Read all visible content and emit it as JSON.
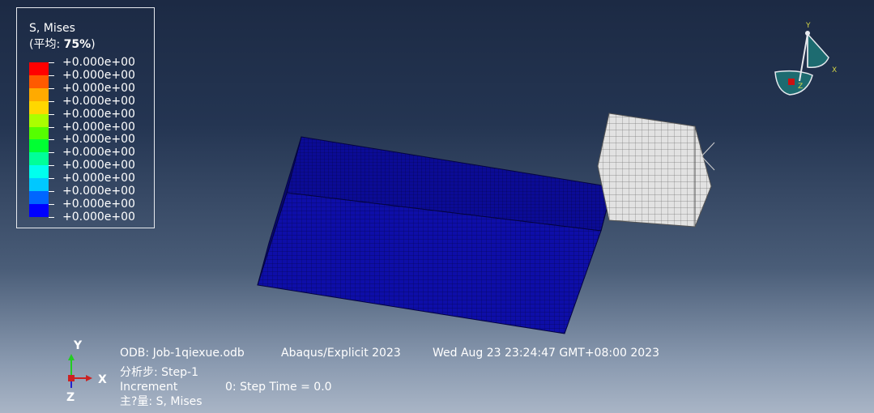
{
  "legend": {
    "title": "S, Mises",
    "subtitle_prefix": "(平均: ",
    "subtitle_value": "75%",
    "subtitle_suffix": ")",
    "colors": [
      "#ff0000",
      "#ff5a00",
      "#ffaa00",
      "#ffd700",
      "#aaff00",
      "#55ff00",
      "#00ff33",
      "#00ff99",
      "#00ffee",
      "#00c8ff",
      "#0066ff",
      "#0000ff"
    ],
    "values": [
      "+0.000e+00",
      "+0.000e+00",
      "+0.000e+00",
      "+0.000e+00",
      "+0.000e+00",
      "+0.000e+00",
      "+0.000e+00",
      "+0.000e+00",
      "+0.000e+00",
      "+0.000e+00",
      "+0.000e+00",
      "+0.000e+00",
      "+0.000e+00"
    ]
  },
  "triad": {
    "y_label": "Y",
    "x_label": "X",
    "z_label": "Z"
  },
  "axes": {
    "y_label": "Y",
    "x_label": "X",
    "z_label": "Z"
  },
  "info": {
    "odb": "ODB: Job-1qiexue.odb",
    "solver": "Abaqus/Explicit 2023",
    "datetime": "Wed Aug 23 23:24:47 GMT+08:00 2023",
    "step_label": "分析步: Step-1",
    "increment_label": "Increment",
    "increment_value": "0: Step Time =  0.0",
    "primary_var": "主?量: S, Mises"
  },
  "colors": {
    "slab": "#0b0b96",
    "cube": "#d9d9d9"
  }
}
